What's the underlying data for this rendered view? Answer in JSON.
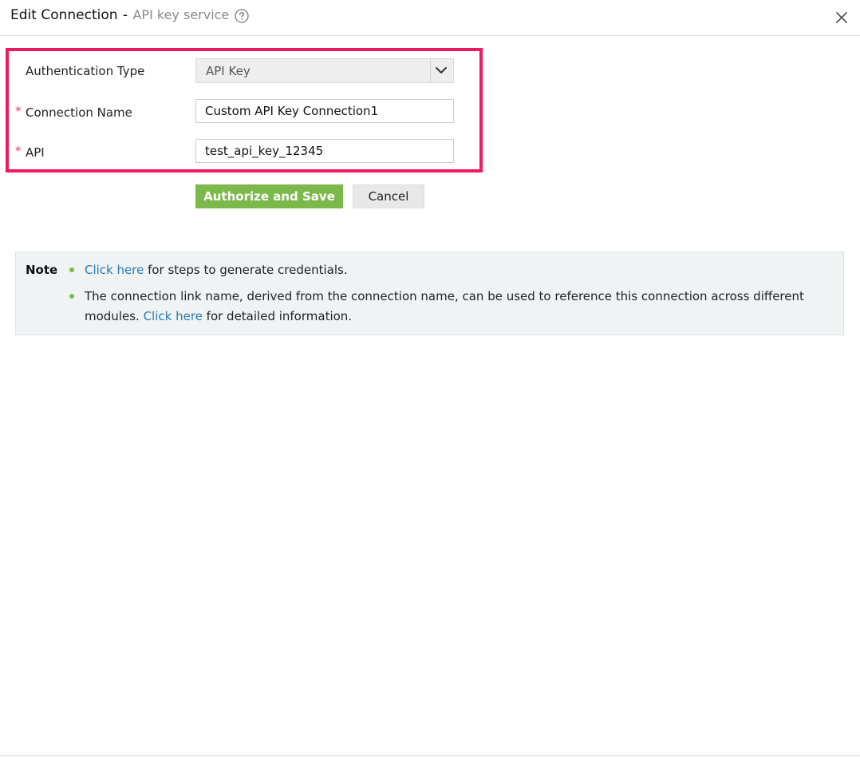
{
  "header": {
    "title": "Edit Connection",
    "separator": "-",
    "service_name": "API key service",
    "help_icon": "question-circle-icon",
    "close_icon": "close-icon"
  },
  "form": {
    "auth_type": {
      "label": "Authentication Type",
      "value": "API Key",
      "icon": "chevron-down-icon"
    },
    "connection_name": {
      "label": "Connection Name",
      "required_mark": "*",
      "value": "Custom API Key Connection1"
    },
    "api": {
      "label": "API",
      "required_mark": "*",
      "value": "test_api_key_12345"
    },
    "highlight_color": "#f0195d"
  },
  "actions": {
    "authorize_label": "Authorize and Save",
    "cancel_label": "Cancel",
    "primary_color": "#7cb84a"
  },
  "note": {
    "title": "Note",
    "items": [
      {
        "link": "Click here",
        "text": " for steps to generate credentials."
      },
      {
        "text_line1": "The connection link name, derived from the connection name, can be used to reference this connection across different",
        "text_line2_prefix": "modules. ",
        "link": "Click here",
        "text_line2_suffix": " for detailed information."
      }
    ]
  }
}
